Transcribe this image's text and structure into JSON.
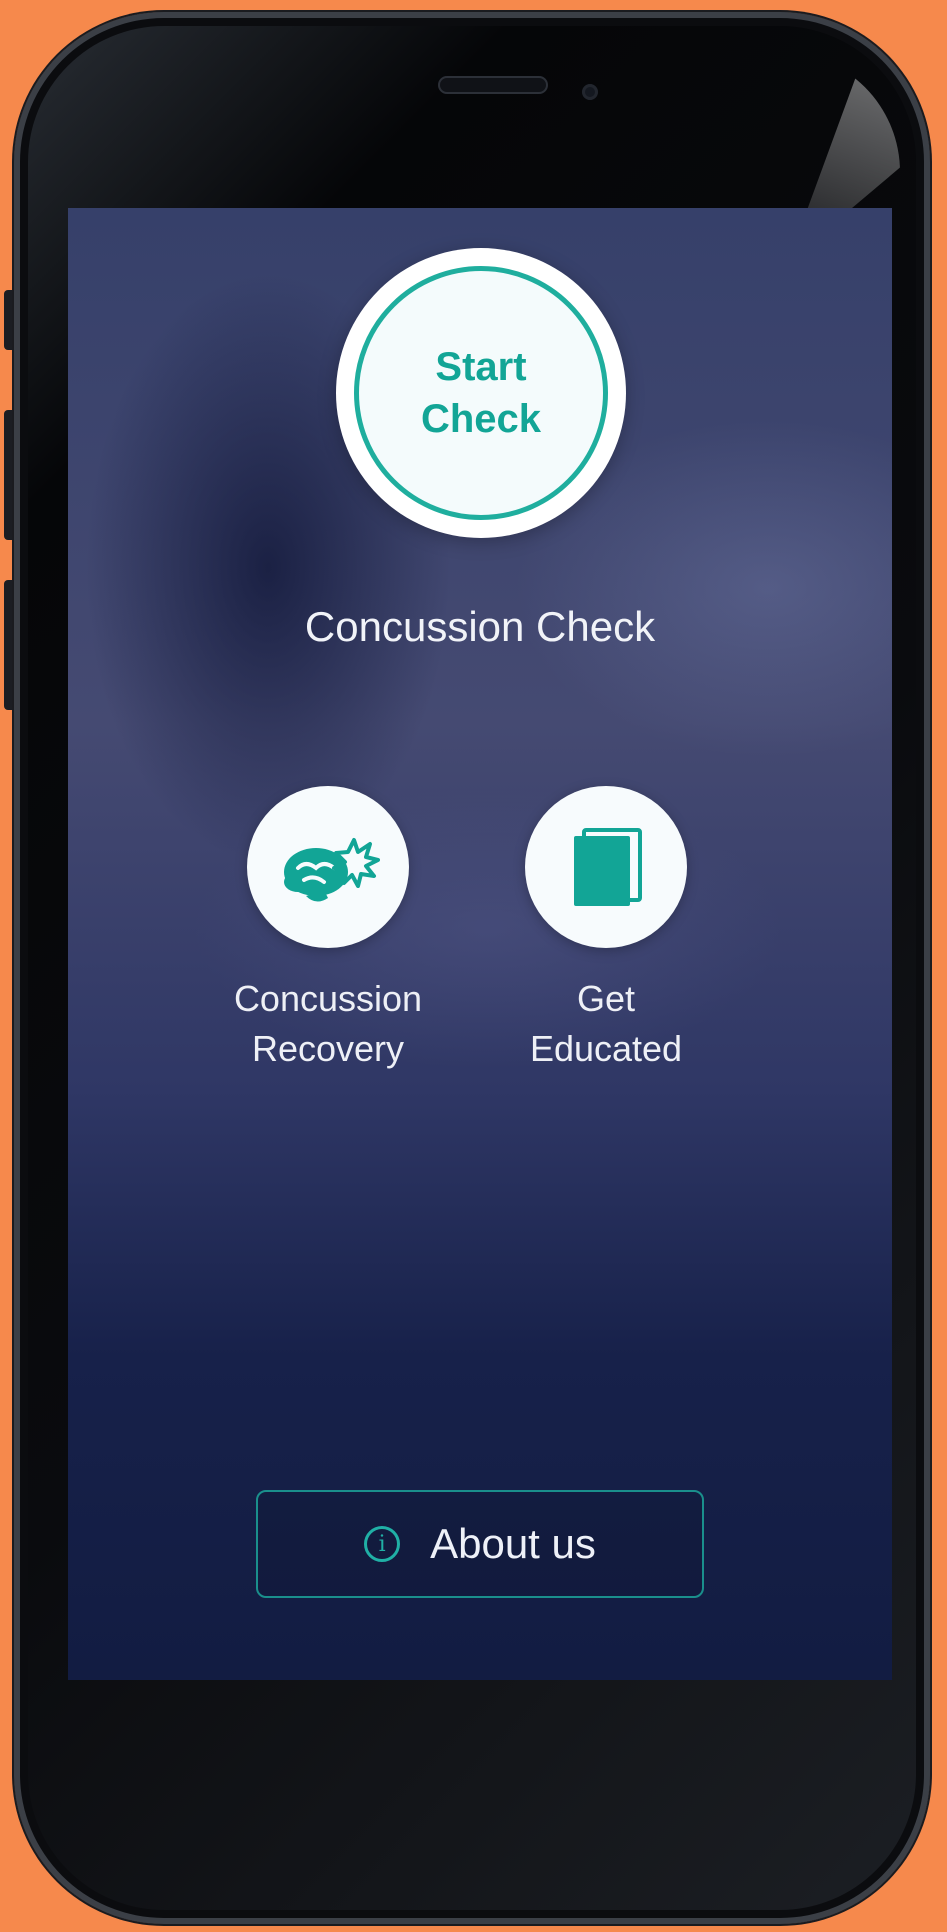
{
  "start_button": {
    "line1": "Start",
    "line2": "Check"
  },
  "main_title": "Concussion Check",
  "tiles": [
    {
      "line1": "Concussion",
      "line2": "Recovery",
      "icon": "brain-impact-icon"
    },
    {
      "line1": "Get",
      "line2": "Educated",
      "icon": "book-icon"
    }
  ],
  "about_button": {
    "label": "About us",
    "icon": "info-icon"
  },
  "colors": {
    "background": "#f6894c",
    "accent": "#12a596",
    "screen_top": "#36406a",
    "screen_bottom": "#121c42"
  }
}
